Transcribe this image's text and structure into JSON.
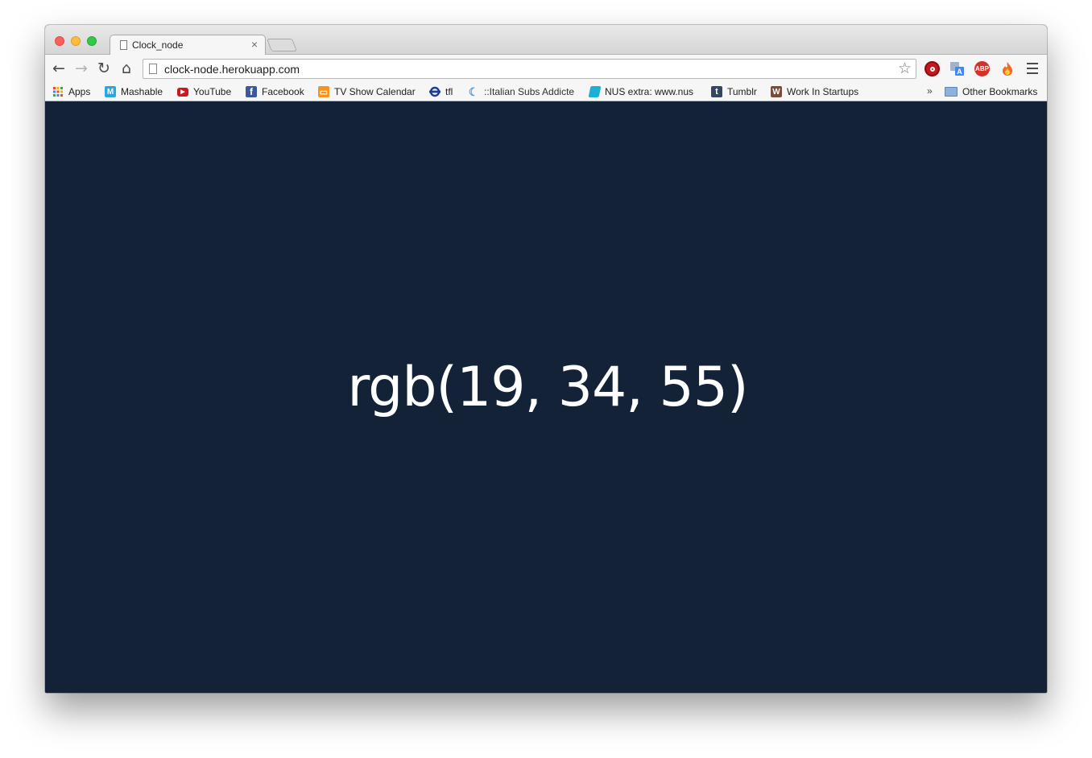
{
  "tab": {
    "title": "Clock_node",
    "close_glyph": "×"
  },
  "toolbar": {
    "back_glyph": "←",
    "forward_glyph": "→",
    "reload_glyph": "↻",
    "home_glyph": "⌂",
    "url": "clock-node.herokuapp.com",
    "star_glyph": "☆"
  },
  "extensions": {
    "abp_label": "ABP",
    "translate_label": "A",
    "fire_glyph": "🔥"
  },
  "bookmarks": {
    "items": [
      {
        "label": "Apps",
        "icon": "apps-grid-icon",
        "color": "#e24b3b"
      },
      {
        "label": "Mashable",
        "icon": "mashable-icon",
        "color": "#2aa7e0",
        "glyph": "M"
      },
      {
        "label": "YouTube",
        "icon": "youtube-icon",
        "color": "#cc181e",
        "glyph": "▶"
      },
      {
        "label": "Facebook",
        "icon": "facebook-icon",
        "color": "#3b5998",
        "glyph": "f"
      },
      {
        "label": "TV Show Calendar",
        "icon": "tv-icon",
        "color": "#f7941d",
        "glyph": "▭"
      },
      {
        "label": "tfl",
        "icon": "tfl-roundel-icon",
        "color": "#1c3f94",
        "glyph": "⊖"
      },
      {
        "label": "::Italian Subs Addicte",
        "icon": "moon-icon",
        "color": "#5aa0d8",
        "glyph": "☾"
      },
      {
        "label": "NUS extra: www.nus",
        "icon": "nus-icon",
        "color": "#1bb1d4",
        "glyph": ""
      },
      {
        "label": "Tumblr",
        "icon": "tumblr-icon",
        "color": "#36465d",
        "glyph": "t"
      },
      {
        "label": "Work In Startups",
        "icon": "wis-icon",
        "color": "#7a4c3a",
        "glyph": "W"
      }
    ],
    "overflow": "»",
    "other": "Other Bookmarks"
  },
  "page": {
    "text": "rgb(19, 34, 55)",
    "background": "#132237"
  }
}
